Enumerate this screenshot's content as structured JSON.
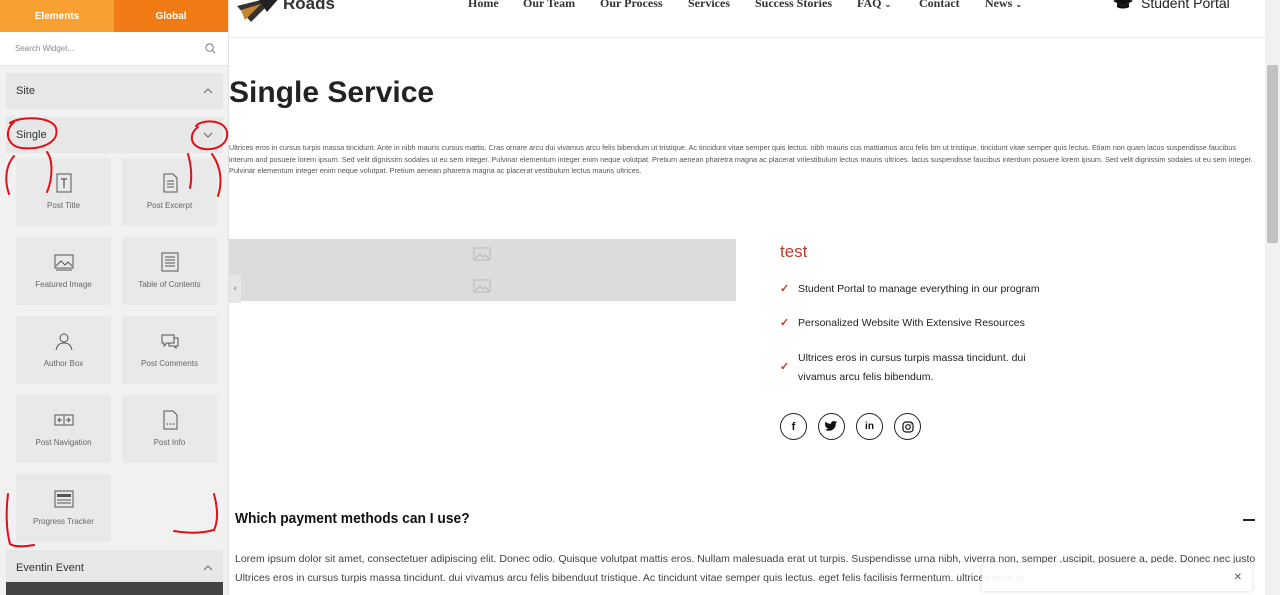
{
  "sidebar": {
    "tabs": [
      "Elements",
      "Global"
    ],
    "search_placeholder": "Search Widget...",
    "sections": {
      "site": "Site",
      "single": "Single",
      "eventin": "Eventin Event"
    },
    "widgets": [
      {
        "label": "Post Title",
        "icon": "post-title-icon"
      },
      {
        "label": "Post Excerpt",
        "icon": "post-excerpt-icon"
      },
      {
        "label": "Featured Image",
        "icon": "featured-image-icon"
      },
      {
        "label": "Table of Contents",
        "icon": "table-of-contents-icon"
      },
      {
        "label": "Author Box",
        "icon": "author-box-icon"
      },
      {
        "label": "Post Comments",
        "icon": "post-comments-icon"
      },
      {
        "label": "Post Navigation",
        "icon": "post-navigation-icon"
      },
      {
        "label": "Post Info",
        "icon": "post-info-icon"
      },
      {
        "label": "Progress Tracker",
        "icon": "progress-tracker-icon"
      }
    ]
  },
  "header": {
    "logo": "Roads",
    "nav": [
      "Home",
      "Our Team",
      "Our Process",
      "Services",
      "Success Stories",
      "FAQ",
      "Contact",
      "News"
    ],
    "portal": "Student Portal"
  },
  "content": {
    "title": "Single Service",
    "intro": "Ultrices eros in cursus turpis massa tincidunt. Ante in nibh mauris cursus mattis. Cras ornare arcu dui vivamus arcu felis bibendum ut tristique. Ac tincidunt vitae semper quis lectus. nibh mauris cus mattiamus arcu felis bm ut tristique. tincidunt vitae semper quis lectus. Etiam non quam lacus suspendisse faucibus interum and posuere lorem ipsum. Sed velit dignissim sodales ut eu sem integer. Pulvinar elementum integer enim neque volutpat. Pretium aenean pharetra magna ac placerat vrilestibulum lectus mauris ultrices. lacus suspendisse faucibus interdum posuere lorem ipsum. Sed velit dignissim sodales ut eu sem integer. Pulvinar elementum integer enim neque volutpat. Pretium aenean pharetra magna ac placerat vestibulum lectus mauris ultrices.",
    "test_title": "test",
    "checklist": [
      "Student Portal to manage everything in our program",
      "Personalized Website With Extensive Resources",
      "Ultrices eros in cursus turpis massa tincidunt. dui vivamus arcu felis bibendum."
    ],
    "social": [
      {
        "icon": "facebook-icon",
        "glyph": "f"
      },
      {
        "icon": "twitter-icon",
        "glyph": "t"
      },
      {
        "icon": "linkedin-icon",
        "glyph": "in"
      },
      {
        "icon": "instagram-icon",
        "glyph": "◎"
      }
    ],
    "faq": {
      "question": "Which payment methods can I use?",
      "answer": "Lorem ipsum dolor sit amet, consectetuer adipiscing elit. Donec odio. Quisque volutpat mattis eros. Nullam malesuada erat ut turpis. Suspendisse urna nibh, viverra non, semper .uscipit, posuere a, pede. Donec nec justo Ultrices eros in cursus turpis massa tincidunt. dui vivamus arcu felis bibenduut tristique. Ac tincidunt vitae semper quis lectus. eget felis facilisis fermentum. ultrices eros in"
    }
  },
  "colors": {
    "tab_elements": "#f9a033",
    "tab_global": "#f07a14",
    "accent_red": "#c0392b",
    "annotation_red": "#e0101a"
  }
}
